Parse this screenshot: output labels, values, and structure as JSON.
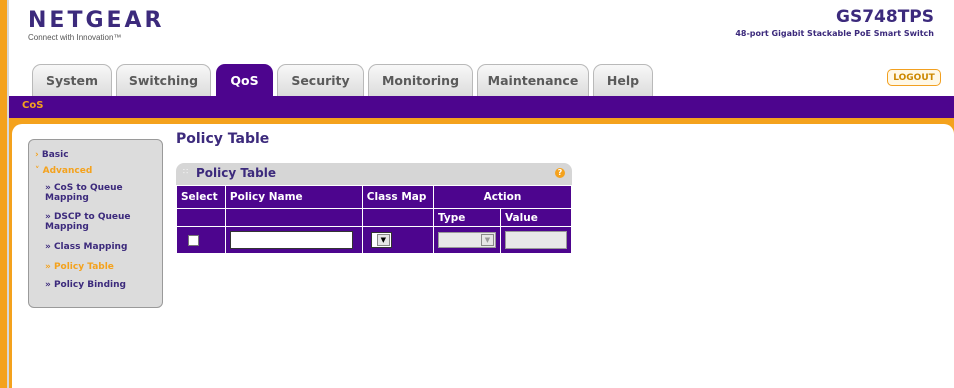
{
  "header": {
    "logo_text": "NETGEAR",
    "logo_tagline": "Connect with Innovation™",
    "model_name": "GS748TPS",
    "model_desc": "48-port Gigabit Stackable PoE Smart Switch",
    "logout_label": "LOGOUT"
  },
  "tabs": [
    {
      "label": "System"
    },
    {
      "label": "Switching"
    },
    {
      "label": "QoS",
      "active": true
    },
    {
      "label": "Security"
    },
    {
      "label": "Monitoring"
    },
    {
      "label": "Maintenance"
    },
    {
      "label": "Help"
    }
  ],
  "subnav": {
    "label": "CoS"
  },
  "menu": {
    "basic": "Basic",
    "advanced": "Advanced",
    "items": [
      {
        "label": "» CoS to Queue Mapping"
      },
      {
        "label": "» DSCP to Queue Mapping"
      },
      {
        "label": "» Class Mapping"
      },
      {
        "label": "» Policy Table",
        "active": true
      },
      {
        "label": "» Policy Binding"
      }
    ]
  },
  "page_title": "Policy Table",
  "policy_table": {
    "title": "Policy Table",
    "help_glyph": "?",
    "columns": {
      "select": "Select",
      "policy_name": "Policy Name",
      "class_map": "Class Map",
      "action": "Action",
      "type": "Type",
      "value": "Value"
    },
    "row": {
      "policy_name_value": "",
      "class_map_value": "",
      "type_value": "",
      "value_value": ""
    }
  },
  "colors": {
    "purple": "#4d058e",
    "orange": "#f4a21d",
    "brand_text": "#3c2a7c"
  }
}
